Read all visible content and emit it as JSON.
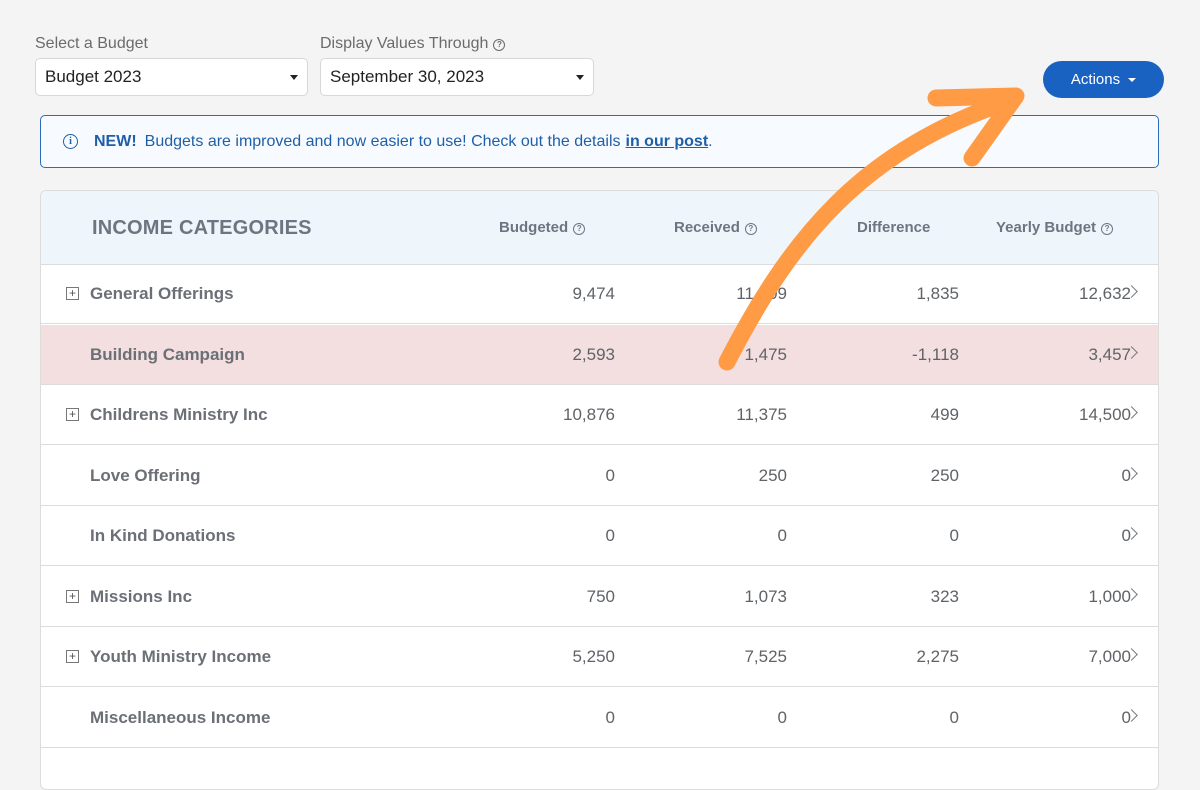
{
  "filters": {
    "budget_label": "Select a Budget",
    "budget_value": "Budget 2023",
    "through_label": "Display Values Through",
    "through_value": "September 30, 2023"
  },
  "actions_label": "Actions",
  "notice": {
    "new": "NEW!",
    "text": "Budgets are improved and now easier to use! Check out the details",
    "link": "in our post",
    "end": "."
  },
  "table": {
    "title": "INCOME CATEGORIES",
    "columns": [
      "Budgeted",
      "Received",
      "Difference",
      "Yearly Budget"
    ],
    "rows": [
      {
        "name": "General Offerings",
        "expandable": true,
        "budgeted": "9,474",
        "received": "11,309",
        "difference": "1,835",
        "yearly": "12,632"
      },
      {
        "name": "Building Campaign",
        "expandable": false,
        "budgeted": "2,593",
        "received": "1,475",
        "difference": "-1,118",
        "yearly": "3,457",
        "highlight": true
      },
      {
        "name": "Childrens Ministry Inc",
        "expandable": true,
        "budgeted": "10,876",
        "received": "11,375",
        "difference": "499",
        "yearly": "14,500"
      },
      {
        "name": "Love Offering",
        "expandable": false,
        "budgeted": "0",
        "received": "250",
        "difference": "250",
        "yearly": "0"
      },
      {
        "name": "In Kind Donations",
        "expandable": false,
        "budgeted": "0",
        "received": "0",
        "difference": "0",
        "yearly": "0"
      },
      {
        "name": "Missions Inc",
        "expandable": true,
        "budgeted": "750",
        "received": "1,073",
        "difference": "323",
        "yearly": "1,000"
      },
      {
        "name": "Youth Ministry Income",
        "expandable": true,
        "budgeted": "5,250",
        "received": "7,525",
        "difference": "2,275",
        "yearly": "7,000"
      },
      {
        "name": "Miscellaneous Income",
        "expandable": false,
        "budgeted": "0",
        "received": "0",
        "difference": "0",
        "yearly": "0"
      }
    ]
  },
  "colors": {
    "accent": "#1a62c2",
    "highlight_row": "#f3dfe0",
    "annotation_arrow": "#ff9a45"
  }
}
